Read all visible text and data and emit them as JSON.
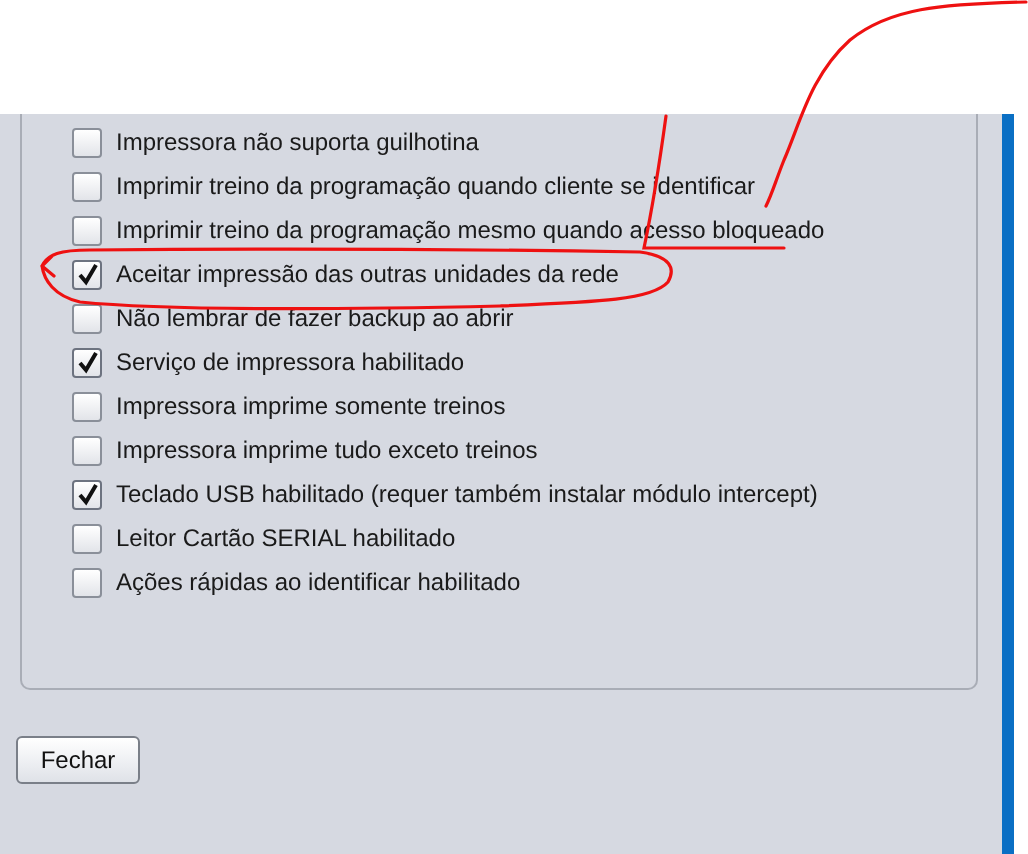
{
  "options": [
    {
      "label": "Impressora não suporta guilhotina",
      "checked": false
    },
    {
      "label": "Imprimir treino da programação quando cliente se identificar",
      "checked": false
    },
    {
      "label": "Imprimir treino da programação mesmo quando acesso bloqueado",
      "checked": false
    },
    {
      "label": "Aceitar impressão das outras unidades da rede",
      "checked": true
    },
    {
      "label": "Não lembrar de fazer backup ao abrir",
      "checked": false
    },
    {
      "label": "Serviço de impressora habilitado",
      "checked": true
    },
    {
      "label": "Impressora imprime somente treinos",
      "checked": false
    },
    {
      "label": "Impressora imprime tudo exceto treinos",
      "checked": false
    },
    {
      "label": "Teclado USB habilitado (requer também instalar módulo intercept)",
      "checked": true
    },
    {
      "label": "Leitor Cartão SERIAL habilitado",
      "checked": false
    },
    {
      "label": "Ações rápidas ao identificar habilitado",
      "checked": false
    }
  ],
  "close_button": {
    "label": "Fechar"
  }
}
